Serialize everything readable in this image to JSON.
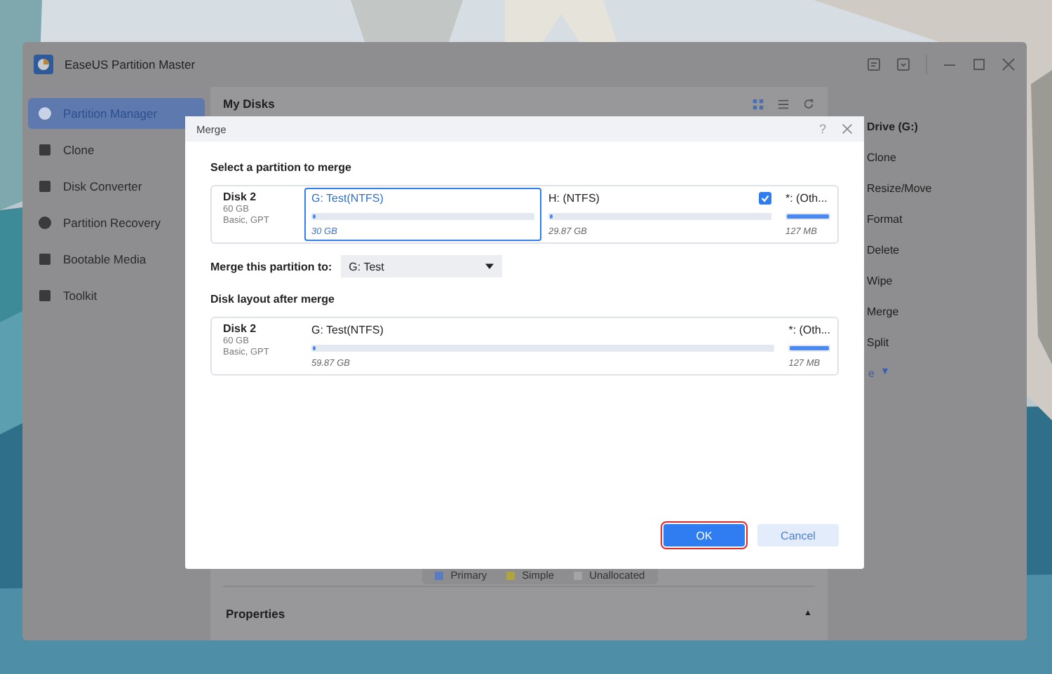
{
  "window": {
    "title": "EaseUS Partition Master"
  },
  "sidebar": {
    "items": [
      {
        "label": "Partition Manager",
        "selected": true
      },
      {
        "label": "Clone",
        "selected": false
      },
      {
        "label": "Disk Converter",
        "selected": false
      },
      {
        "label": "Partition Recovery",
        "selected": false
      },
      {
        "label": "Bootable Media",
        "selected": false
      },
      {
        "label": "Toolkit",
        "selected": false
      }
    ]
  },
  "main": {
    "title": "My Disks",
    "legend": [
      {
        "label": "Primary",
        "color": "#5a7cc0"
      },
      {
        "label": "Simple",
        "color": "#aea542"
      },
      {
        "label": "Unallocated",
        "color": "#a4a4a6"
      }
    ],
    "properties": "Properties",
    "properties_caret": "▲"
  },
  "actions_panel": {
    "title": "Drive (G:)",
    "items": [
      "Clone",
      "Resize/Move",
      "Format",
      "Delete",
      "Wipe",
      "Merge",
      "Split"
    ],
    "more": "e",
    "more_caret": "▼"
  },
  "dialog": {
    "title": "Merge",
    "help": "?",
    "select_heading": "Select a partition to merge",
    "disk": {
      "name": "Disk 2",
      "size": "60 GB",
      "type": "Basic, GPT"
    },
    "partitions": [
      {
        "label": "G: Test(NTFS)",
        "size": "30 GB",
        "level": 0.01,
        "selected": true,
        "checked": false,
        "kind": "partition"
      },
      {
        "label": "H: (NTFS)",
        "size": "29.87 GB",
        "level": 0.01,
        "selected": false,
        "checked": true,
        "kind": "partition"
      },
      {
        "label": "*: (Oth...",
        "size": "127 MB",
        "level": 1,
        "selected": false,
        "checked": false,
        "kind": "other"
      }
    ],
    "merge_to": {
      "label": "Merge this partition to:",
      "value": "G: Test"
    },
    "after_heading": "Disk layout after merge",
    "after_disk": {
      "name": "Disk 2",
      "size": "60 GB",
      "type": "Basic, GPT"
    },
    "after_partitions": [
      {
        "label": "G: Test(NTFS)",
        "size": "59.87 GB",
        "level": 0.005,
        "kind": "partition"
      },
      {
        "label": "*: (Oth...",
        "size": "127 MB",
        "level": 1,
        "kind": "other"
      }
    ],
    "buttons": [
      {
        "label": "OK",
        "kind": "primary",
        "focused": true
      },
      {
        "label": "Cancel",
        "kind": "secondary",
        "focused": false
      }
    ]
  }
}
